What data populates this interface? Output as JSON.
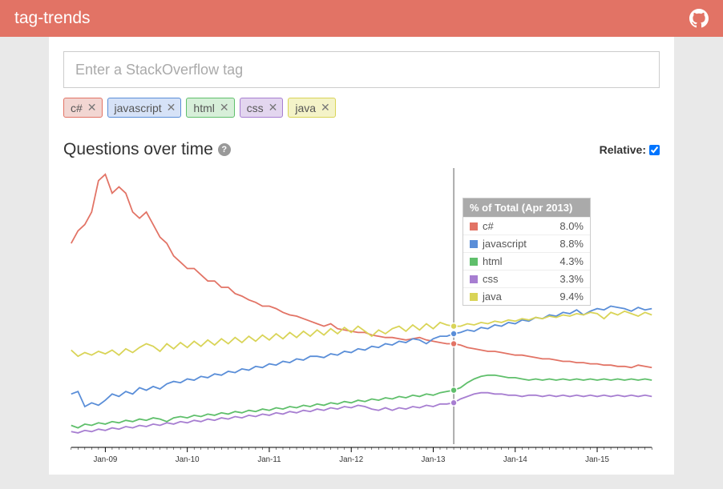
{
  "header": {
    "title": "tag-trends"
  },
  "search": {
    "placeholder": "Enter a StackOverflow tag",
    "value": ""
  },
  "tags": [
    {
      "name": "c#",
      "bg": "#f2d6d2",
      "border": "#e27365"
    },
    {
      "name": "javascript",
      "bg": "#d6e2f7",
      "border": "#5a8ed8"
    },
    {
      "name": "html",
      "bg": "#d7efd9",
      "border": "#5fbf6b"
    },
    {
      "name": "css",
      "bg": "#e3d6ef",
      "border": "#a77ed1"
    },
    {
      "name": "java",
      "bg": "#f4f3c8",
      "border": "#d9d457"
    }
  ],
  "chart_title": "Questions over time",
  "relative": {
    "label": "Relative:",
    "checked": true
  },
  "tooltip": {
    "title": "% of Total (Apr 2013)",
    "rows": [
      {
        "name": "c#",
        "value": "8.0%",
        "color": "#e27365"
      },
      {
        "name": "javascript",
        "value": "8.8%",
        "color": "#5a8ed8"
      },
      {
        "name": "html",
        "value": "4.3%",
        "color": "#5fbf6b"
      },
      {
        "name": "css",
        "value": "3.3%",
        "color": "#a77ed1"
      },
      {
        "name": "java",
        "value": "9.4%",
        "color": "#d9d457"
      }
    ]
  },
  "chart_data": {
    "type": "line",
    "title": "Questions over time",
    "xlabel": "",
    "ylabel": "",
    "x_unit": "month",
    "x_start": "2008-08",
    "x_ticks": [
      "Jan-09",
      "Jan-10",
      "Jan-11",
      "Jan-12",
      "Jan-13",
      "Jan-14",
      "Jan-15"
    ],
    "y_unit": "percent_of_total",
    "ylim": [
      0,
      22
    ],
    "hover_index": 56,
    "series": [
      {
        "name": "c#",
        "color": "#e27365",
        "values": [
          16.0,
          17.0,
          17.5,
          18.5,
          21.0,
          21.5,
          20.0,
          20.5,
          20.0,
          18.5,
          18.0,
          18.5,
          17.5,
          16.5,
          16.0,
          15.0,
          14.5,
          14.0,
          14.0,
          13.5,
          13.0,
          13.0,
          12.5,
          12.5,
          12.0,
          11.8,
          11.5,
          11.3,
          11.0,
          11.0,
          10.8,
          10.5,
          10.3,
          10.2,
          10.0,
          9.8,
          9.6,
          9.4,
          9.6,
          9.2,
          9.1,
          9.0,
          8.9,
          8.9,
          8.7,
          8.6,
          8.5,
          8.5,
          8.4,
          8.3,
          8.4,
          8.5,
          8.3,
          8.2,
          8.1,
          8.0,
          8.0,
          7.9,
          7.7,
          7.6,
          7.5,
          7.4,
          7.4,
          7.3,
          7.2,
          7.1,
          7.1,
          7.0,
          6.9,
          6.8,
          6.8,
          6.7,
          6.6,
          6.6,
          6.5,
          6.5,
          6.4,
          6.4,
          6.3,
          6.3,
          6.2,
          6.2,
          6.1,
          6.3,
          6.2,
          6.1
        ]
      },
      {
        "name": "javascript",
        "color": "#5a8ed8",
        "values": [
          4.0,
          4.2,
          3.0,
          3.3,
          3.1,
          3.5,
          4.0,
          3.8,
          4.2,
          4.0,
          4.5,
          4.3,
          4.6,
          4.4,
          4.8,
          5.0,
          4.9,
          5.2,
          5.1,
          5.4,
          5.3,
          5.6,
          5.5,
          5.8,
          5.7,
          6.0,
          5.9,
          6.2,
          6.1,
          6.4,
          6.3,
          6.6,
          6.5,
          6.8,
          6.7,
          7.0,
          7.0,
          6.9,
          7.2,
          7.1,
          7.4,
          7.3,
          7.6,
          7.5,
          7.8,
          7.7,
          8.0,
          7.9,
          8.2,
          8.1,
          8.4,
          8.3,
          8.0,
          8.4,
          8.6,
          8.6,
          8.8,
          8.9,
          9.1,
          9.0,
          9.3,
          9.2,
          9.5,
          9.4,
          9.7,
          9.6,
          9.9,
          9.8,
          10.1,
          10.0,
          10.3,
          10.2,
          10.5,
          10.4,
          10.7,
          10.3,
          10.6,
          10.8,
          10.7,
          11.0,
          10.9,
          10.8,
          10.6,
          10.9,
          10.7,
          10.8
        ]
      },
      {
        "name": "html",
        "color": "#5fbf6b",
        "values": [
          1.5,
          1.3,
          1.6,
          1.5,
          1.7,
          1.6,
          1.8,
          1.7,
          1.9,
          1.8,
          2.0,
          1.9,
          2.1,
          2.0,
          1.8,
          2.1,
          2.2,
          2.1,
          2.3,
          2.2,
          2.4,
          2.3,
          2.5,
          2.4,
          2.6,
          2.5,
          2.7,
          2.6,
          2.8,
          2.7,
          2.9,
          2.8,
          3.0,
          2.9,
          3.1,
          3.0,
          3.2,
          3.1,
          3.3,
          3.2,
          3.4,
          3.3,
          3.5,
          3.4,
          3.6,
          3.5,
          3.7,
          3.6,
          3.8,
          3.7,
          3.9,
          3.8,
          4.0,
          3.9,
          4.1,
          4.2,
          4.3,
          4.5,
          4.9,
          5.2,
          5.4,
          5.5,
          5.5,
          5.4,
          5.3,
          5.3,
          5.2,
          5.1,
          5.2,
          5.1,
          5.2,
          5.1,
          5.2,
          5.1,
          5.2,
          5.1,
          5.2,
          5.1,
          5.2,
          5.1,
          5.2,
          5.1,
          5.2,
          5.1,
          5.2,
          5.1
        ]
      },
      {
        "name": "css",
        "color": "#a77ed1",
        "values": [
          1.0,
          0.9,
          1.1,
          1.0,
          1.2,
          1.1,
          1.3,
          1.2,
          1.4,
          1.3,
          1.5,
          1.4,
          1.6,
          1.5,
          1.7,
          1.6,
          1.8,
          1.7,
          1.9,
          1.8,
          2.0,
          1.9,
          2.1,
          2.0,
          2.2,
          2.1,
          2.3,
          2.2,
          2.4,
          2.3,
          2.5,
          2.4,
          2.6,
          2.5,
          2.7,
          2.6,
          2.8,
          2.7,
          2.9,
          2.8,
          3.0,
          2.9,
          3.1,
          3.0,
          2.8,
          2.7,
          2.9,
          2.7,
          2.9,
          2.8,
          3.0,
          2.9,
          3.1,
          3.0,
          3.2,
          3.2,
          3.3,
          3.6,
          3.8,
          4.0,
          4.1,
          4.1,
          4.0,
          4.0,
          3.9,
          3.9,
          3.8,
          3.9,
          3.9,
          3.8,
          3.9,
          3.8,
          3.9,
          3.8,
          3.9,
          3.8,
          3.9,
          3.8,
          3.9,
          3.8,
          3.9,
          3.8,
          3.9,
          3.8,
          3.9,
          3.8
        ]
      },
      {
        "name": "java",
        "color": "#d9d457",
        "values": [
          7.5,
          7.0,
          7.3,
          7.1,
          7.4,
          7.2,
          7.5,
          7.1,
          7.6,
          7.3,
          7.7,
          8.0,
          7.8,
          7.4,
          8.0,
          7.6,
          8.1,
          7.7,
          8.2,
          7.8,
          8.3,
          7.9,
          8.4,
          8.0,
          8.5,
          8.1,
          8.6,
          8.2,
          8.7,
          8.3,
          8.8,
          8.4,
          8.9,
          8.5,
          9.0,
          8.6,
          9.1,
          8.7,
          9.2,
          8.8,
          9.3,
          8.9,
          9.4,
          9.0,
          8.6,
          9.1,
          8.8,
          9.2,
          9.4,
          9.0,
          9.5,
          9.1,
          9.6,
          9.2,
          9.7,
          9.5,
          9.4,
          9.4,
          9.6,
          9.5,
          9.7,
          9.6,
          9.8,
          9.7,
          9.9,
          9.8,
          10.0,
          9.9,
          10.1,
          10.0,
          10.2,
          10.1,
          10.3,
          10.2,
          10.4,
          10.3,
          10.5,
          10.4,
          10.0,
          10.5,
          10.3,
          10.6,
          10.4,
          10.2,
          10.5,
          10.3
        ]
      }
    ]
  }
}
